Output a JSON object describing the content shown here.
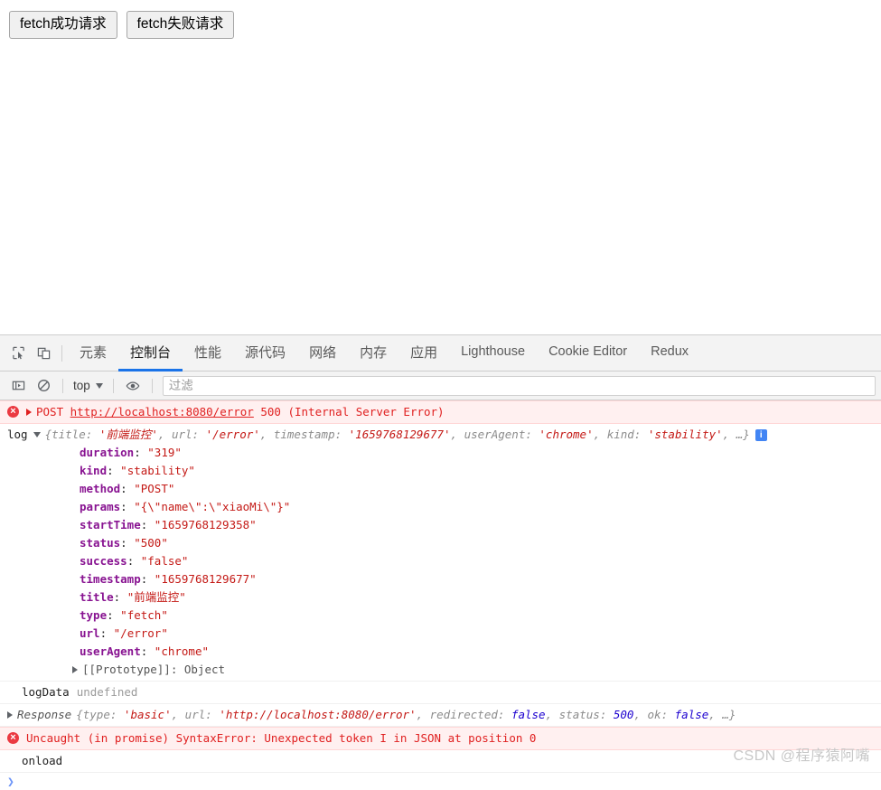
{
  "webpage": {
    "buttons": [
      {
        "label": "fetch成功请求",
        "name": "fetch-success-button"
      },
      {
        "label": "fetch失败请求",
        "name": "fetch-fail-button"
      }
    ]
  },
  "devtools": {
    "toolbar_icons": [
      {
        "name": "inspect-element-icon",
        "title": "检查元素"
      },
      {
        "name": "device-toolbar-icon",
        "title": "切换设备工具栏"
      }
    ],
    "tabs": [
      {
        "label": "元素",
        "active": false,
        "cjk": true
      },
      {
        "label": "控制台",
        "active": true,
        "cjk": true
      },
      {
        "label": "性能",
        "active": false,
        "cjk": true
      },
      {
        "label": "源代码",
        "active": false,
        "cjk": true
      },
      {
        "label": "网络",
        "active": false,
        "cjk": true
      },
      {
        "label": "内存",
        "active": false,
        "cjk": true
      },
      {
        "label": "应用",
        "active": false,
        "cjk": true
      },
      {
        "label": "Lighthouse",
        "active": false,
        "cjk": false
      },
      {
        "label": "Cookie Editor",
        "active": false,
        "cjk": false
      },
      {
        "label": "Redux",
        "active": false,
        "cjk": false
      }
    ],
    "console_toolbar": {
      "sidebar_toggle_name": "console-sidebar-toggle-icon",
      "clear_console_name": "clear-console-icon",
      "context_value": "top",
      "eye_icon_name": "live-expression-eye-icon",
      "filter_placeholder": "过滤",
      "filter_value": ""
    },
    "console": {
      "error_request": {
        "method": "POST",
        "url": "http://localhost:8080/error",
        "status": "500",
        "status_text": "(Internal Server Error)"
      },
      "log_entry": {
        "label": "log",
        "preview_open_brace": "{",
        "preview_items": [
          {
            "key": "title",
            "value": "'前端监控'"
          },
          {
            "key": "url",
            "value": "'/error'"
          },
          {
            "key": "timestamp",
            "value": "'1659768129677'"
          },
          {
            "key": "userAgent",
            "value": "'chrome'"
          },
          {
            "key": "kind",
            "value": "'stability'"
          }
        ],
        "preview_ellipsis": "…}",
        "info_badge": "i",
        "properties": [
          {
            "key": "duration",
            "value": "\"319\""
          },
          {
            "key": "kind",
            "value": "\"stability\""
          },
          {
            "key": "method",
            "value": "\"POST\""
          },
          {
            "key": "params",
            "value": "\"{\\\"name\\\":\\\"xiaoMi\\\"}\""
          },
          {
            "key": "startTime",
            "value": "\"1659768129358\""
          },
          {
            "key": "status",
            "value": "\"500\""
          },
          {
            "key": "success",
            "value": "\"false\""
          },
          {
            "key": "timestamp",
            "value": "\"1659768129677\""
          },
          {
            "key": "title",
            "value": "\"前端监控\""
          },
          {
            "key": "type",
            "value": "\"fetch\""
          },
          {
            "key": "url",
            "value": "\"/error\""
          },
          {
            "key": "userAgent",
            "value": "\"chrome\""
          }
        ],
        "prototype_label": "[[Prototype]]: Object"
      },
      "log_data": {
        "name": "logData",
        "value": "undefined"
      },
      "response_entry": {
        "name": "Response",
        "open_brace": "{",
        "items": [
          {
            "key": "type",
            "value": "'basic'",
            "kind": "str"
          },
          {
            "key": "url",
            "value": "'http://localhost:8080/error'",
            "kind": "str"
          },
          {
            "key": "redirected",
            "value": "false",
            "kind": "bool"
          },
          {
            "key": "status",
            "value": "500",
            "kind": "num"
          },
          {
            "key": "ok",
            "value": "false",
            "kind": "bool"
          }
        ],
        "ellipsis": "…}"
      },
      "uncaught_error": "Uncaught (in promise) SyntaxError: Unexpected token I in JSON at position 0",
      "onload_text": "onload",
      "prompt_symbol": "❯"
    }
  },
  "watermark": "CSDN @程序猿阿嘴",
  "colors": {
    "accent": "#1a73e8",
    "error_red": "#e02020",
    "error_bg": "#fff0f0",
    "prop_key_purple": "#881391",
    "string_red": "#c41a16",
    "number_blue": "#1c00cf",
    "info_blue": "#4285f4"
  }
}
